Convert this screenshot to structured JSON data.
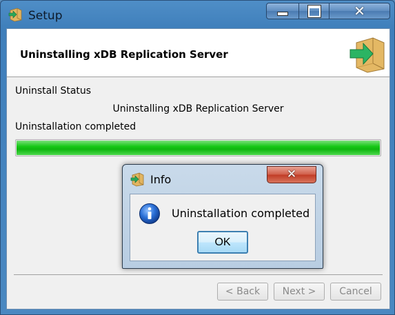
{
  "window": {
    "title": "Setup",
    "icon": "setup-box-arrow-icon"
  },
  "header": {
    "title": "Uninstalling xDB Replication Server",
    "logo": "setup-box-arrow-icon"
  },
  "status": {
    "label": "Uninstall Status",
    "detail": "Uninstalling xDB Replication Server",
    "message": "Uninstallation completed",
    "progress_fraction": 1.0,
    "progress_color": "#17c817"
  },
  "footer": {
    "back_label": "< Back",
    "next_label": "Next >",
    "cancel_label": "Cancel"
  },
  "dialog": {
    "title": "Info",
    "message": "Uninstallation completed",
    "ok_label": "OK",
    "message_icon": "info-icon",
    "close_color": "#c03b25"
  }
}
